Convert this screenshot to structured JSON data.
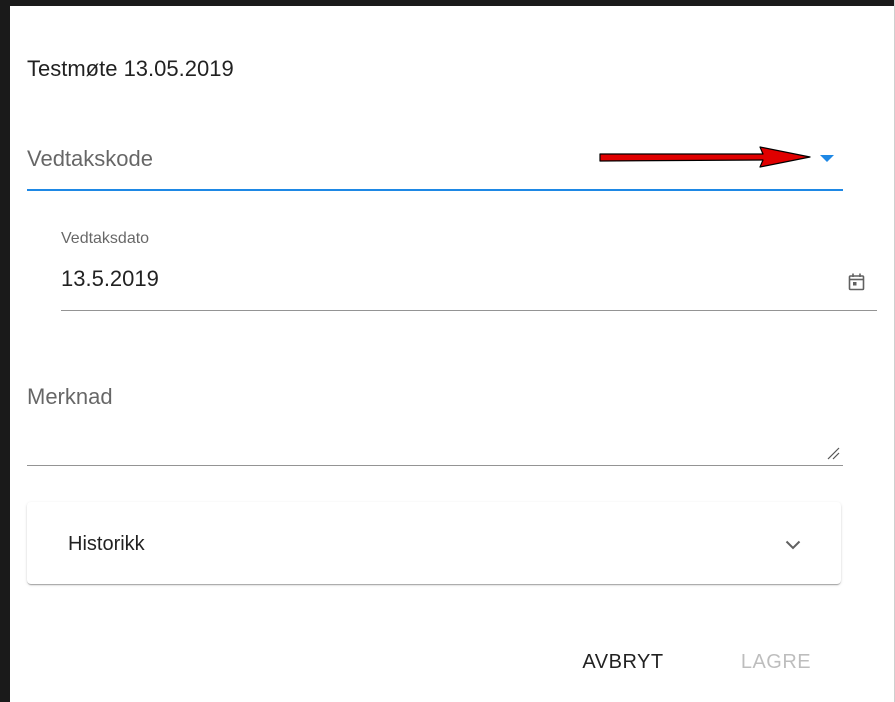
{
  "dialog": {
    "title": "Testmøte 13.05.2019"
  },
  "decision_code_select": {
    "placeholder": "Vedtakskode",
    "accent_color": "#1e88e5",
    "icon": "arrow-drop-down-icon"
  },
  "decision_date_field": {
    "label": "Vedtaksdato",
    "value": "13.5.2019",
    "icon": "calendar-icon"
  },
  "remark_field": {
    "label": "Merknad",
    "value": ""
  },
  "history_panel": {
    "title": "Historikk",
    "icon": "chevron-down-icon",
    "expanded": false
  },
  "actions": {
    "cancel_label": "AVBRYT",
    "save_label": "LAGRE",
    "save_disabled": true
  },
  "annotation": {
    "icon": "red-arrow-pointer",
    "color": "#e00000"
  }
}
